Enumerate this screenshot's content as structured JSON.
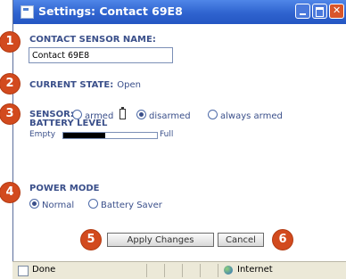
{
  "window": {
    "title": "Settings: Contact 69E8"
  },
  "sensor_name": {
    "label": "CONTACT SENSOR NAME:",
    "value": "Contact 69E8"
  },
  "current_state": {
    "label": "CURRENT STATE:",
    "value": "Open"
  },
  "sensor": {
    "label": "SENSOR:",
    "options": [
      {
        "label": "armed",
        "selected": false
      },
      {
        "label": "disarmed",
        "selected": true
      },
      {
        "label": "always armed",
        "selected": false
      }
    ]
  },
  "battery": {
    "label": "BATTERY LEVEL",
    "empty_label": "Empty",
    "full_label": "Full",
    "level_percent": 45
  },
  "power_mode": {
    "label": "POWER MODE",
    "options": [
      {
        "label": "Normal",
        "selected": true
      },
      {
        "label": "Battery Saver",
        "selected": false
      }
    ]
  },
  "buttons": {
    "apply": "Apply Changes",
    "cancel": "Cancel"
  },
  "callouts": [
    "1",
    "2",
    "3",
    "4",
    "5",
    "6"
  ],
  "statusbar": {
    "left": "Done",
    "zone": "Internet"
  },
  "colors": {
    "badge": "#d24a1e",
    "titlebar": "#2f63cf",
    "label": "#3a4f8a"
  }
}
